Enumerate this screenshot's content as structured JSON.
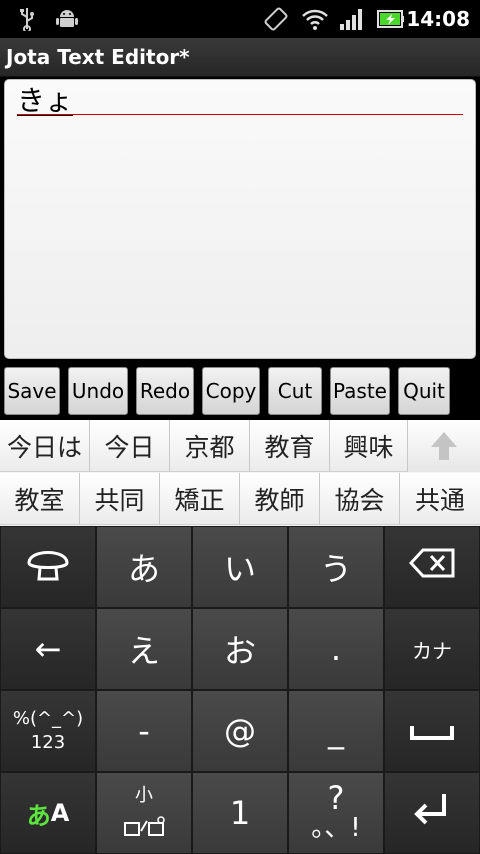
{
  "status_bar": {
    "time": "14:08",
    "icons": [
      "usb-icon",
      "android-debug-icon",
      "rotate-icon",
      "wifi-icon",
      "signal-icon",
      "battery-charging-icon"
    ]
  },
  "titlebar": {
    "title": "Jota Text Editor*"
  },
  "editor": {
    "text": "きょ"
  },
  "toolbar": {
    "buttons": [
      "Save",
      "Undo",
      "Redo",
      "Copy",
      "Cut",
      "Paste",
      "Quit"
    ]
  },
  "candidates": {
    "row1": [
      "今日は",
      "今日",
      "京都",
      "教育",
      "興味"
    ],
    "row2": [
      "教室",
      "共同",
      "矯正",
      "教師",
      "協会",
      "共通"
    ]
  },
  "keyboard": {
    "row1": [
      "mushroom-icon",
      "あ",
      "い",
      "う",
      "backspace-icon"
    ],
    "row2": [
      "←",
      "え",
      "お",
      ".",
      "カナ"
    ],
    "row3": [
      "%(^_^)",
      "123",
      "-",
      "@",
      "_",
      "space-icon"
    ],
    "row4": [
      "あ",
      "A",
      "小",
      "1",
      "?",
      "。、!",
      "enter-icon"
    ]
  },
  "colors": {
    "accent_green": "#5ce53f",
    "underline_red": "#d40000"
  }
}
